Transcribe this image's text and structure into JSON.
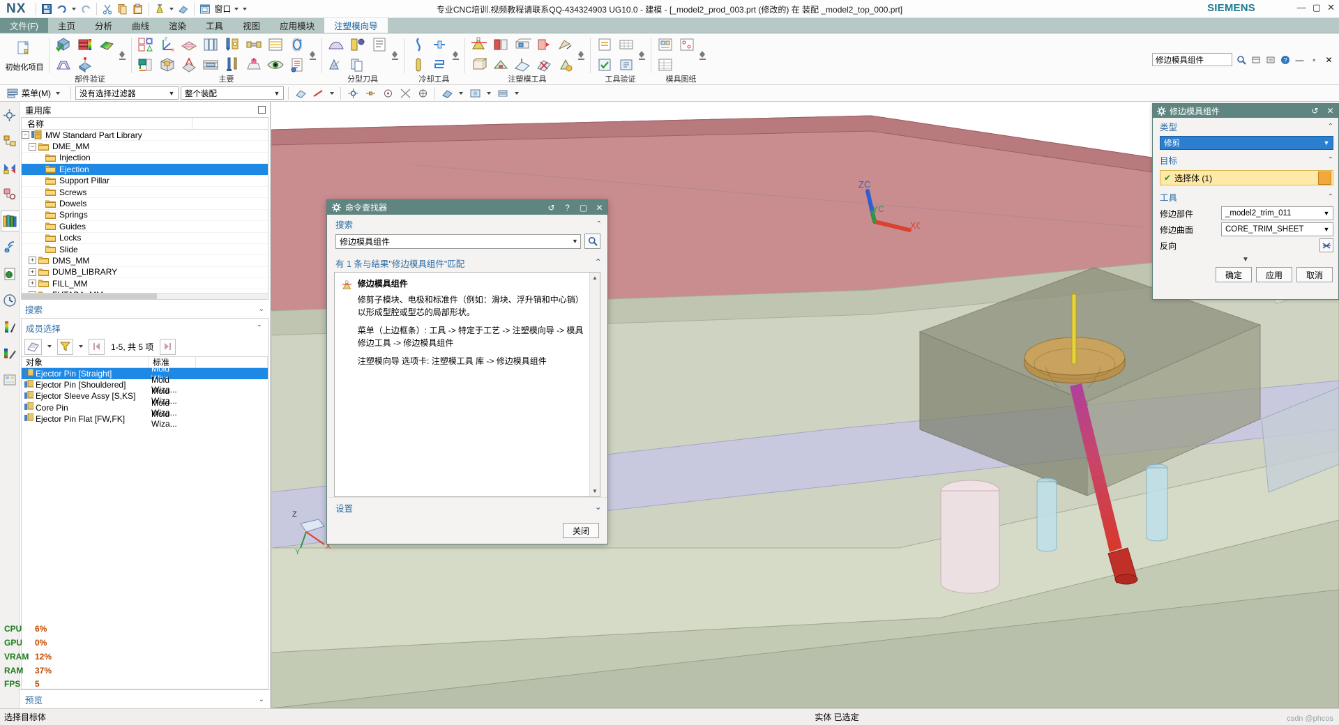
{
  "app": {
    "logo": "NX",
    "title": "专业CNC培训.视频教程请联系QQ-434324903 UG10.0 - 建模 - [_model2_prod_003.prt  (修改的)    在 装配 _model2_top_000.prt]",
    "brand": "SIEMENS",
    "window_controls": {
      "minimize": "—",
      "maximize": "▢",
      "close": "✕"
    }
  },
  "quick_access": {
    "window_label": "窗口",
    "items": [
      {
        "name": "save-icon",
        "label": "保存"
      },
      {
        "name": "undo-icon",
        "label": "撤销"
      },
      {
        "name": "redo-icon",
        "label": "重做"
      },
      {
        "name": "cut-icon",
        "label": "剪切"
      },
      {
        "name": "copy-icon",
        "label": "复制"
      },
      {
        "name": "paste-icon",
        "label": "粘贴"
      },
      {
        "name": "measure-icon",
        "label": "测量"
      },
      {
        "name": "eraser-icon",
        "label": "擦除"
      },
      {
        "name": "window-icon",
        "label": "窗口"
      }
    ]
  },
  "tabs": [
    {
      "id": "file",
      "label": "文件(F)"
    },
    {
      "id": "home",
      "label": "主页"
    },
    {
      "id": "analysis",
      "label": "分析"
    },
    {
      "id": "curve",
      "label": "曲线"
    },
    {
      "id": "render",
      "label": "渲染"
    },
    {
      "id": "tools",
      "label": "工具"
    },
    {
      "id": "view",
      "label": "视图"
    },
    {
      "id": "apps",
      "label": "应用模块"
    },
    {
      "id": "moldwizard",
      "label": "注塑模向导"
    }
  ],
  "active_tab": "注塑模向导",
  "ribbon": {
    "groups": [
      {
        "name": "init",
        "label": "",
        "big_button": {
          "label": "初始化项目"
        },
        "icons": []
      },
      {
        "name": "part-validate",
        "label": "部件验证",
        "icons": [
          "mold-check",
          "core-cavity",
          "layers",
          "inject-gate",
          "rainbow-block"
        ]
      },
      {
        "name": "main",
        "label": "主要",
        "icons": [
          "layout",
          "wcs",
          "block",
          "parting",
          "insert",
          "plate",
          "pin",
          "bolt",
          "slide",
          "pattern",
          "hatch",
          "clamp",
          "table",
          "eye",
          "loop",
          "doc"
        ]
      },
      {
        "name": "parting-tools",
        "label": "分型刀具",
        "icons": [
          "surface",
          "ball",
          "copy-face",
          "list"
        ]
      },
      {
        "name": "cooling-tools",
        "label": "冷却工具",
        "icons": [
          "channel",
          "rod",
          "pipe",
          "connector"
        ]
      },
      {
        "name": "mold-tools",
        "label": "注塑模工具",
        "icons": [
          "trim",
          "box",
          "split",
          "cut",
          "fill",
          "solid",
          "patch",
          "split2",
          "edge",
          "repair"
        ]
      },
      {
        "name": "tool-validate",
        "label": "工具验证",
        "icons": [
          "check1",
          "check2"
        ]
      },
      {
        "name": "mold-drawing",
        "label": "模具图纸",
        "icons": [
          "draw1",
          "draw2",
          "draw3"
        ]
      }
    ],
    "command_search": {
      "value": "修边模具组件",
      "placeholder": "命令查找器"
    }
  },
  "selection_bar": {
    "menu_label": "菜单(M)",
    "filter_combo": "没有选择过滤器",
    "scope_combo": "整个装配"
  },
  "left_panel": {
    "title": "重用库",
    "tree_headers": {
      "name": "名称",
      "extra": ""
    },
    "tree": [
      {
        "label": "MW Standard Part Library",
        "depth": 0,
        "expander": "−",
        "icon": "library-icon",
        "selected": false
      },
      {
        "label": "DME_MM",
        "depth": 1,
        "expander": "−",
        "icon": "folder-icon",
        "selected": false
      },
      {
        "label": "Injection",
        "depth": 2,
        "expander": "",
        "icon": "folder-icon",
        "selected": false
      },
      {
        "label": "Ejection",
        "depth": 2,
        "expander": "",
        "icon": "folder-icon",
        "selected": true
      },
      {
        "label": "Support Pillar",
        "depth": 2,
        "expander": "",
        "icon": "folder-icon",
        "selected": false
      },
      {
        "label": "Screws",
        "depth": 2,
        "expander": "",
        "icon": "folder-icon",
        "selected": false
      },
      {
        "label": "Dowels",
        "depth": 2,
        "expander": "",
        "icon": "folder-icon",
        "selected": false
      },
      {
        "label": "Springs",
        "depth": 2,
        "expander": "",
        "icon": "folder-icon",
        "selected": false
      },
      {
        "label": "Guides",
        "depth": 2,
        "expander": "",
        "icon": "folder-icon",
        "selected": false
      },
      {
        "label": "Locks",
        "depth": 2,
        "expander": "",
        "icon": "folder-icon",
        "selected": false
      },
      {
        "label": "Slide",
        "depth": 2,
        "expander": "",
        "icon": "folder-icon",
        "selected": false
      },
      {
        "label": "DMS_MM",
        "depth": 1,
        "expander": "+",
        "icon": "folder-icon",
        "selected": false
      },
      {
        "label": "DUMB_LIBRARY",
        "depth": 1,
        "expander": "+",
        "icon": "folder-icon",
        "selected": false
      },
      {
        "label": "FILL_MM",
        "depth": 1,
        "expander": "+",
        "icon": "folder-icon",
        "selected": false
      },
      {
        "label": "FUTABA_MM",
        "depth": 1,
        "expander": "+",
        "icon": "folder-icon",
        "selected": false
      }
    ],
    "search_label": "搜索",
    "member_select_label": "成员选择",
    "page_info": "1-5, 共 5 项",
    "member_headers": {
      "object": "对象",
      "standard": "标准"
    },
    "members": [
      {
        "object": "Ejector Pin [Straight]",
        "standard": "Mold Wiza...",
        "selected": true
      },
      {
        "object": "Ejector Pin [Shouldered]",
        "standard": "Mold Wiza...",
        "selected": false
      },
      {
        "object": "Ejector Sleeve Assy [S,KS]",
        "standard": "Mold Wiza...",
        "selected": false
      },
      {
        "object": "Core Pin",
        "standard": "Mold Wiza...",
        "selected": false
      },
      {
        "object": "Ejector Pin Flat [FW,FK]",
        "standard": "Mold Wiza...",
        "selected": false
      }
    ],
    "preview_label": "预览"
  },
  "stats": [
    {
      "key": "CPU",
      "value": "6%"
    },
    {
      "key": "GPU",
      "value": "0%"
    },
    {
      "key": "VRAM",
      "value": "12%"
    },
    {
      "key": "RAM",
      "value": "37%"
    },
    {
      "key": "FPS",
      "value": "5"
    }
  ],
  "viewport": {
    "triad": {
      "z": "ZC",
      "x": "XC",
      "y": "YC"
    },
    "csys": {
      "z": "Z",
      "x": "X",
      "y": "Y"
    }
  },
  "command_finder_dialog": {
    "title": "命令查找器",
    "titlebar_buttons": {
      "reset": "↺",
      "help": "?",
      "maximize": "▢",
      "close": "✕"
    },
    "search_label": "搜索",
    "search_value": "修边模具组件",
    "search_icon": "magnifier-icon",
    "results_label": "有 1 条与结果\"修边模具组件\"匹配",
    "result": {
      "title": "修边模具组件",
      "paragraphs": [
        "修剪子模块、电极和标准件（例如：滑块、浮升销和中心销）以形成型腔或型芯的局部形状。",
        "菜单（上边框条）: 工具 -> 特定于工艺 -> 注塑模向导 -> 模具修边工具 -> 修边模具组件",
        "注塑模向导 选项卡: 注塑模工具 库 -> 修边模具组件"
      ]
    },
    "settings_label": "设置",
    "close_button": "关闭"
  },
  "trim_dialog": {
    "title": "修边模具组件",
    "titlebar_buttons": {
      "reset": "↺",
      "close": "✕"
    },
    "sections": {
      "type_label": "类型",
      "target_label": "目标",
      "tool_label": "工具"
    },
    "type_value": "修剪",
    "selection_label": "选择体 (1)",
    "fields": [
      {
        "label": "修边部件",
        "value": "_model2_trim_011",
        "type": "combo"
      },
      {
        "label": "修边曲面",
        "value": "CORE_TRIM_SHEET",
        "type": "combo"
      },
      {
        "label": "反向",
        "value": "",
        "type": "button"
      }
    ],
    "buttons": {
      "ok": "确定",
      "apply": "应用",
      "cancel": "取消"
    }
  },
  "statusbar": {
    "left": "选择目标体",
    "center": "实体 已选定",
    "watermark": "csdn @phcos"
  }
}
